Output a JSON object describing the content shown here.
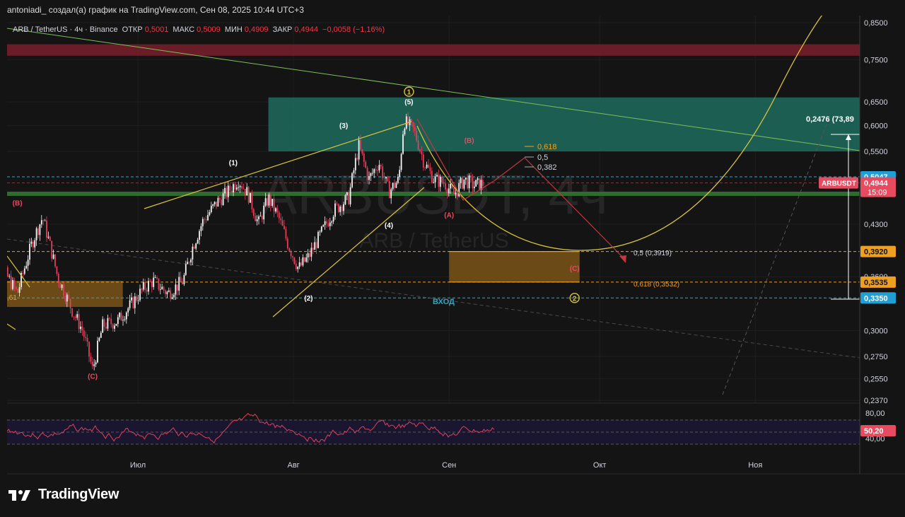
{
  "header": {
    "author_line": "antoniadi_ создал(а) график на TradingView.com, Сен 08, 2025 10:44 UTC+3"
  },
  "legend": {
    "symbol": "ARB / TetherUS · 4ч · Binance",
    "open_label": "ОТКР",
    "open": "0,5001",
    "high_label": "МАКС",
    "high": "0,5009",
    "low_label": "МИН",
    "low": "0,4909",
    "close_label": "ЗАКР",
    "close": "0,4944",
    "change": "−0,0058 (−1,16%)"
  },
  "watermark": {
    "big": "ARBUSDT, 4ч",
    "small": "ARB / TetherUS"
  },
  "footer": {
    "brand": "TradingView"
  },
  "colors": {
    "background": "#141414",
    "candle_up": "#f5f5f5",
    "candle_down": "#e0405a",
    "rsi": "#e0405a",
    "yellow": "#d9c43c",
    "teal_zone": "#1f6b5e",
    "orange_zone": "#7a5418",
    "red_zone": "#7a1f2a",
    "green_band": "#2f6b2f",
    "blue_dashed": "#2aa9c7",
    "green_trend": "#7bbf5a",
    "label_price": "#e84a5f",
    "label_blue": "#1f9fd4",
    "label_orange": "#f0a020"
  },
  "chart_data": {
    "type": "candlestick",
    "symbol": "ARBUSDT",
    "exchange": "Binance",
    "timeframe": "4ч",
    "price_scale": "log",
    "y_ticks": [
      "0,8500",
      "0,7500",
      "0,6500",
      "0,6000",
      "0,5500",
      "0,4300",
      "0,3600",
      "0,3000",
      "0,2750",
      "0,2550",
      "0,2370"
    ],
    "x_ticks": [
      "Июл",
      "Авг",
      "Сен",
      "Окт",
      "Ноя"
    ],
    "x_tick_dates": [
      "2025-07-01",
      "2025-08-01",
      "2025-09-01",
      "2025-10-01",
      "2025-11-01"
    ],
    "price_labels": [
      {
        "value": "0,5047",
        "role": "blue"
      },
      {
        "value": "0,4944",
        "role": "last",
        "symbol": "ARBUSDT",
        "timer": "15:09"
      },
      {
        "value": "0,3920",
        "role": "orange"
      },
      {
        "value": "0,3535",
        "role": "orange"
      },
      {
        "value": "0,3350",
        "role": "blue"
      }
    ],
    "price_path": [
      [
        "2025-06-01",
        0.395
      ],
      [
        "2025-06-04",
        0.37
      ],
      [
        "2025-06-07",
        0.34
      ],
      [
        "2025-06-10",
        0.405
      ],
      [
        "2025-06-12",
        0.44
      ],
      [
        "2025-06-15",
        0.36
      ],
      [
        "2025-06-18",
        0.32
      ],
      [
        "2025-06-20",
        0.3
      ],
      [
        "2025-06-22",
        0.262
      ],
      [
        "2025-06-24",
        0.305
      ],
      [
        "2025-06-27",
        0.31
      ],
      [
        "2025-06-30",
        0.33
      ],
      [
        "2025-07-02",
        0.345
      ],
      [
        "2025-07-04",
        0.355
      ],
      [
        "2025-07-07",
        0.34
      ],
      [
        "2025-07-10",
        0.355
      ],
      [
        "2025-07-12",
        0.4
      ],
      [
        "2025-07-14",
        0.435
      ],
      [
        "2025-07-17",
        0.465
      ],
      [
        "2025-07-19",
        0.48
      ],
      [
        "2025-07-21",
        0.5
      ],
      [
        "2025-07-23",
        0.475
      ],
      [
        "2025-07-25",
        0.43
      ],
      [
        "2025-07-27",
        0.47
      ],
      [
        "2025-07-29",
        0.44
      ],
      [
        "2025-07-31",
        0.4
      ],
      [
        "2025-08-02",
        0.37
      ],
      [
        "2025-08-04",
        0.385
      ],
      [
        "2025-08-06",
        0.41
      ],
      [
        "2025-08-09",
        0.45
      ],
      [
        "2025-08-12",
        0.47
      ],
      [
        "2025-08-14",
        0.56
      ],
      [
        "2025-08-16",
        0.5
      ],
      [
        "2025-08-18",
        0.53
      ],
      [
        "2025-08-20",
        0.48
      ],
      [
        "2025-08-22",
        0.5
      ],
      [
        "2025-08-23",
        0.61
      ],
      [
        "2025-08-25",
        0.59
      ],
      [
        "2025-08-27",
        0.53
      ],
      [
        "2025-08-29",
        0.5
      ],
      [
        "2025-08-31",
        0.495
      ],
      [
        "2025-09-02",
        0.475
      ],
      [
        "2025-09-04",
        0.5
      ],
      [
        "2025-09-06",
        0.49
      ],
      [
        "2025-09-08",
        0.494
      ]
    ],
    "rsi": {
      "label": "50,20",
      "ticks": [
        "80,00",
        "40,00"
      ],
      "levels": [
        70,
        50,
        30
      ]
    },
    "zones": [
      {
        "name": "supply-red",
        "from": "2025-05-29",
        "to": "2025-11-30",
        "low": 0.76,
        "high": 0.79
      },
      {
        "name": "target-teal",
        "from": "2025-07-27",
        "to": "2025-11-30",
        "low": 0.55,
        "high": 0.66
      },
      {
        "name": "entry-orange",
        "from": "2025-09-01",
        "to": "2025-09-27",
        "low": 0.3535,
        "high": 0.392
      },
      {
        "name": "old-orange",
        "from": "2025-05-29",
        "to": "2025-06-28",
        "low": 0.325,
        "high": 0.355
      }
    ],
    "levels": [
      {
        "name": "green-support",
        "value": 0.4765
      },
      {
        "name": "entry-line",
        "value": 0.335,
        "label": "ВХОД"
      },
      {
        "name": "upper-dashed",
        "value": 0.5047
      }
    ],
    "fib_labels": [
      {
        "text": "0,618",
        "value": 0.555
      },
      {
        "text": "0,5",
        "value": 0.533
      },
      {
        "text": "0,382",
        "value": 0.512
      },
      {
        "text": "0,5 (0,3919)",
        "value": 0.392
      },
      {
        "text": "0,618 (0,3532)",
        "value": 0.3532
      }
    ],
    "measure": {
      "label": "0,2476 (73,89",
      "from": 0.335,
      "to": 0.583
    },
    "wave_labels": [
      {
        "text": "(1)",
        "date": "2025-07-20",
        "value": 0.525
      },
      {
        "text": "(2)",
        "date": "2025-08-04",
        "value": 0.332
      },
      {
        "text": "(3)",
        "date": "2025-08-11",
        "value": 0.595
      },
      {
        "text": "(4)",
        "date": "2025-08-20",
        "value": 0.425
      },
      {
        "text": "(5)",
        "date": "2025-08-24",
        "value": 0.645
      },
      {
        "text": "(A)",
        "date": "2025-09-01",
        "value": 0.44
      },
      {
        "text": "(B)",
        "date": "2025-09-05",
        "value": 0.566
      },
      {
        "text": "(C)",
        "date": "2025-09-26",
        "value": 0.367
      },
      {
        "text": "(B)",
        "date": "2025-06-07",
        "value": 0.458
      },
      {
        "text": "(C)",
        "date": "2025-06-22",
        "value": 0.255
      }
    ],
    "circled_labels": [
      {
        "text": "1",
        "date": "2025-08-24",
        "value": 0.673
      },
      {
        "text": "2",
        "date": "2025-09-26",
        "value": 0.335
      }
    ]
  }
}
